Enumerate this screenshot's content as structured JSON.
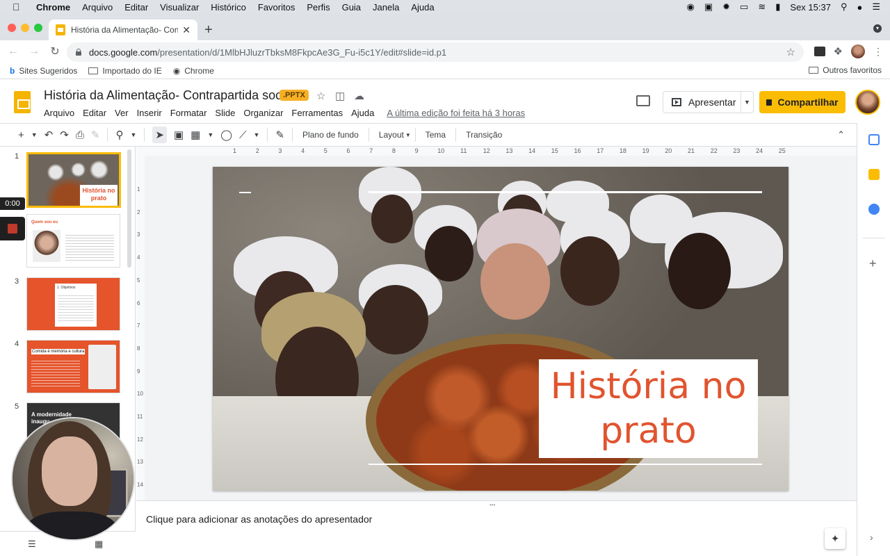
{
  "menubar": {
    "app": "Chrome",
    "items": [
      "Arquivo",
      "Editar",
      "Visualizar",
      "Histórico",
      "Favoritos",
      "Perfis",
      "Guia",
      "Janela",
      "Ajuda"
    ],
    "clock": "Sex 15:37"
  },
  "browser": {
    "tab_title": "História da Alimentação- Contr",
    "url_host": "docs.google.com",
    "url_path": "/presentation/d/1MlbHJluzrTbksM8FkpcAe3G_Fu-i5c1Y/edit#slide=id.p1",
    "bookmarks": [
      "Sites Sugeridos",
      "Importado do IE",
      "Chrome"
    ],
    "other_bookmarks": "Outros favoritos"
  },
  "doc": {
    "title": "História da Alimentação- Contrapartida social",
    "badge": ".PPTX",
    "menu": [
      "Arquivo",
      "Editar",
      "Ver",
      "Inserir",
      "Formatar",
      "Slide",
      "Organizar",
      "Ferramentas",
      "Ajuda"
    ],
    "last_edit": "A última edição foi feita há 3 horas",
    "present_label": "Apresentar",
    "share_label": "Compartilhar"
  },
  "toolbar": {
    "background": "Plano de fundo",
    "layout": "Layout",
    "theme": "Tema",
    "transition": "Transição"
  },
  "filmstrip": {
    "numbers": [
      "1",
      "2",
      "3",
      "4",
      "5"
    ],
    "thumb1_title": "História no prato",
    "thumb2_heading": "Quem sou eu",
    "thumb3_heading": "1. Objetivos",
    "thumb4_heading": "Comida é memória e cultura",
    "thumb5_heading": "A modernidade inaugu..."
  },
  "ruler": {
    "h_ticks": [
      "1",
      "2",
      "3",
      "4",
      "5",
      "6",
      "7",
      "8",
      "9",
      "10",
      "11",
      "12",
      "13",
      "14",
      "15",
      "16",
      "17",
      "18",
      "19",
      "20",
      "21",
      "22",
      "23",
      "24",
      "25"
    ],
    "v_ticks": [
      "1",
      "2",
      "3",
      "4",
      "5",
      "6",
      "7",
      "8",
      "9",
      "10",
      "11",
      "12",
      "13",
      "14"
    ]
  },
  "slide": {
    "title_line1": "História no",
    "title_line2": "prato"
  },
  "notes": {
    "placeholder": "Clique para adicionar as anotações do apresentador"
  },
  "recorder": {
    "timer": "0:00"
  },
  "colors": {
    "accent": "#fbbc04",
    "slide_title": "#e0542f",
    "slide_orange": "#e5542b"
  }
}
